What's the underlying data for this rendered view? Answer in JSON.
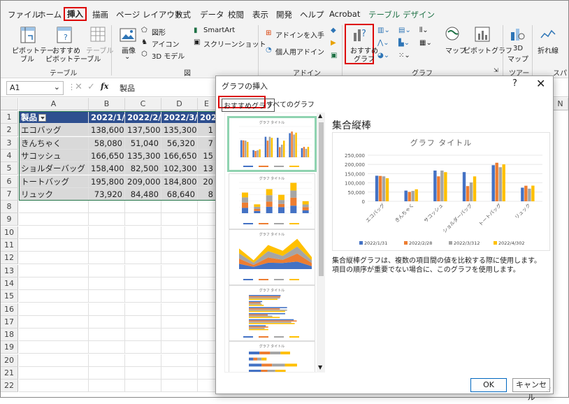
{
  "menu": {
    "items": [
      "ファイル",
      "ホーム",
      "挿入",
      "描画",
      "ページ レイアウト",
      "数式",
      "データ",
      "校閲",
      "表示",
      "開発",
      "ヘルプ",
      "Acrobat",
      "テーブル デザイン"
    ],
    "active": "挿入"
  },
  "ribbon": {
    "pivot_table": "ピボットテーブル",
    "pivot_table_line1": "ピボットテー",
    "pivot_table_line2": "ブル",
    "recommended_pivot_line1": "おすすめ",
    "recommended_pivot_line2": "ピボットテーブル",
    "table": "テーブル",
    "group_table": "テーブル",
    "image": "画像",
    "shapes": "図形",
    "icons": "アイコン",
    "model3d": "3D モデル",
    "smartart": "SmartArt",
    "screenshot": "スクリーンショット",
    "group_figure": "図",
    "get_addins": "アドインを入手",
    "my_addins": "個人用アドイン",
    "group_addins": "アドイン",
    "recommended_charts_line1": "おすすめ",
    "recommended_charts_line2": "グラフ",
    "maps": "マップ",
    "pivot_chart": "ピボットグラフ",
    "group_charts": "グラフ",
    "map3d_line1": "3D",
    "map3d_line2": "マップ",
    "group_tours": "ツアー",
    "line": "折れ線",
    "group_spark": "スパー"
  },
  "formula_bar": {
    "name_box": "A1",
    "fx": "fx",
    "value": "製品"
  },
  "sheet": {
    "columns": [
      "A",
      "B",
      "C",
      "D",
      "E"
    ],
    "header": [
      "製品",
      "2022/1/",
      "2022/2/",
      "2022/3/",
      "202"
    ],
    "rows": [
      [
        "エコバッグ",
        "138,600",
        "137,500",
        "135,300",
        "1"
      ],
      [
        "きんちゃく",
        "58,080",
        "51,040",
        "56,320",
        "7"
      ],
      [
        "サコッシュ",
        "166,650",
        "135,300",
        "166,650",
        "15"
      ],
      [
        "ショルダーバッグ",
        "158,400",
        "82,500",
        "102,300",
        "13"
      ],
      [
        "トートバッグ",
        "195,800",
        "209,000",
        "184,800",
        "20"
      ],
      [
        "リュック",
        "73,920",
        "84,480",
        "68,640",
        "8"
      ]
    ],
    "row_numbers": [
      "1",
      "2",
      "3",
      "4",
      "5",
      "6",
      "7",
      "8",
      "9",
      "10",
      "11",
      "12",
      "13",
      "14",
      "15",
      "16",
      "17",
      "18",
      "19",
      "20",
      "21",
      "22"
    ],
    "extra_col": "N"
  },
  "dialog": {
    "title": "グラフの挿入",
    "help": "?",
    "close": "✕",
    "tab_recommended": "おすすめグラフ",
    "tab_all": "すべてのグラフ",
    "chart_name": "集合縦棒",
    "description": "集合縦棒グラフは、複数の項目間の値を比較する際に使用します。項目の順序が重要でない場合に、このグラフを使用します。",
    "ok": "OK",
    "cancel": "キャンセル",
    "thumb_title": "グラフ タイトル"
  },
  "chart_data": {
    "type": "bar",
    "title": "グラフ タイトル",
    "categories": [
      "エコバッグ",
      "きんちゃく",
      "サコッシュ",
      "ショルダーバッグ",
      "トートバッグ",
      "リュック"
    ],
    "series": [
      {
        "name": "2022/1/31",
        "color": "#4472c4",
        "values": [
          138600,
          58080,
          166650,
          158400,
          195800,
          73920
        ]
      },
      {
        "name": "2022/2/28",
        "color": "#ed7d31",
        "values": [
          137500,
          51040,
          135300,
          82500,
          209000,
          84480
        ]
      },
      {
        "name": "2022/3/312",
        "color": "#a5a5a5",
        "values": [
          135300,
          56320,
          166650,
          102300,
          184800,
          68640
        ]
      },
      {
        "name": "2022/4/302",
        "color": "#ffc000",
        "values": [
          125000,
          65000,
          158000,
          135000,
          200000,
          85000
        ]
      }
    ],
    "yticks": [
      "250,000",
      "200,000",
      "150,000",
      "100,000",
      "50,000",
      "0"
    ],
    "ylim": [
      0,
      250000
    ],
    "legend": "bottom",
    "grid": true
  }
}
